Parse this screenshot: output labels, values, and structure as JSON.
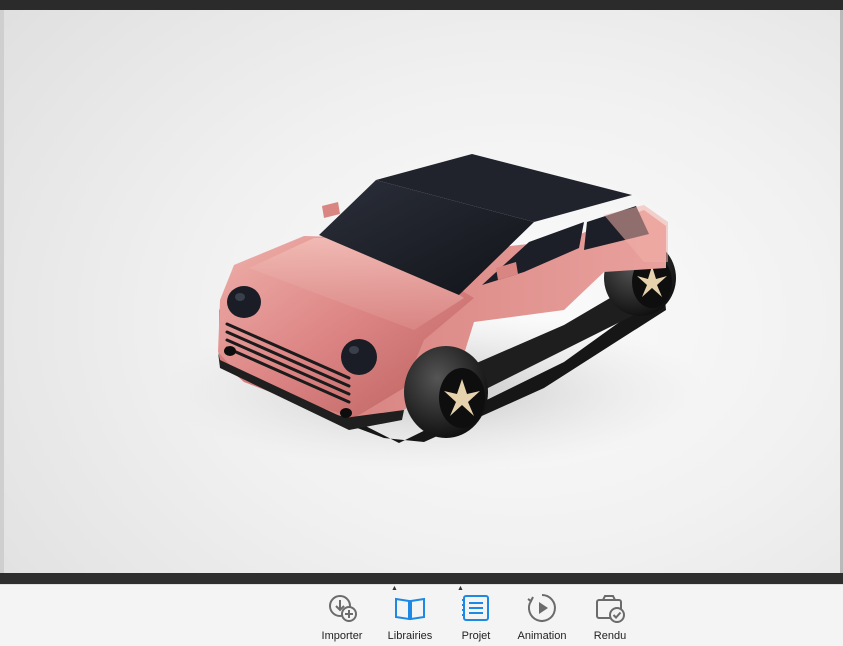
{
  "toolbar": {
    "items": [
      {
        "label": "Importer",
        "icon": "import-icon",
        "active": false,
        "caret": false
      },
      {
        "label": "Librairies",
        "icon": "book-icon",
        "active": true,
        "caret": true
      },
      {
        "label": "Projet",
        "icon": "list-icon",
        "active": true,
        "caret": true
      },
      {
        "label": "Animation",
        "icon": "play-icon",
        "active": false,
        "caret": false
      },
      {
        "label": "Rendu",
        "icon": "render-icon",
        "active": false,
        "caret": false
      }
    ],
    "colors": {
      "active": "#1e88e5",
      "inactive": "#6b6b6b"
    }
  },
  "scene": {
    "object": "car-model",
    "body_color": "#dc8484",
    "window_color": "#1b1d24",
    "base_color": "#1a1a1a",
    "wheel_hub_color": "#e6d3ad"
  }
}
